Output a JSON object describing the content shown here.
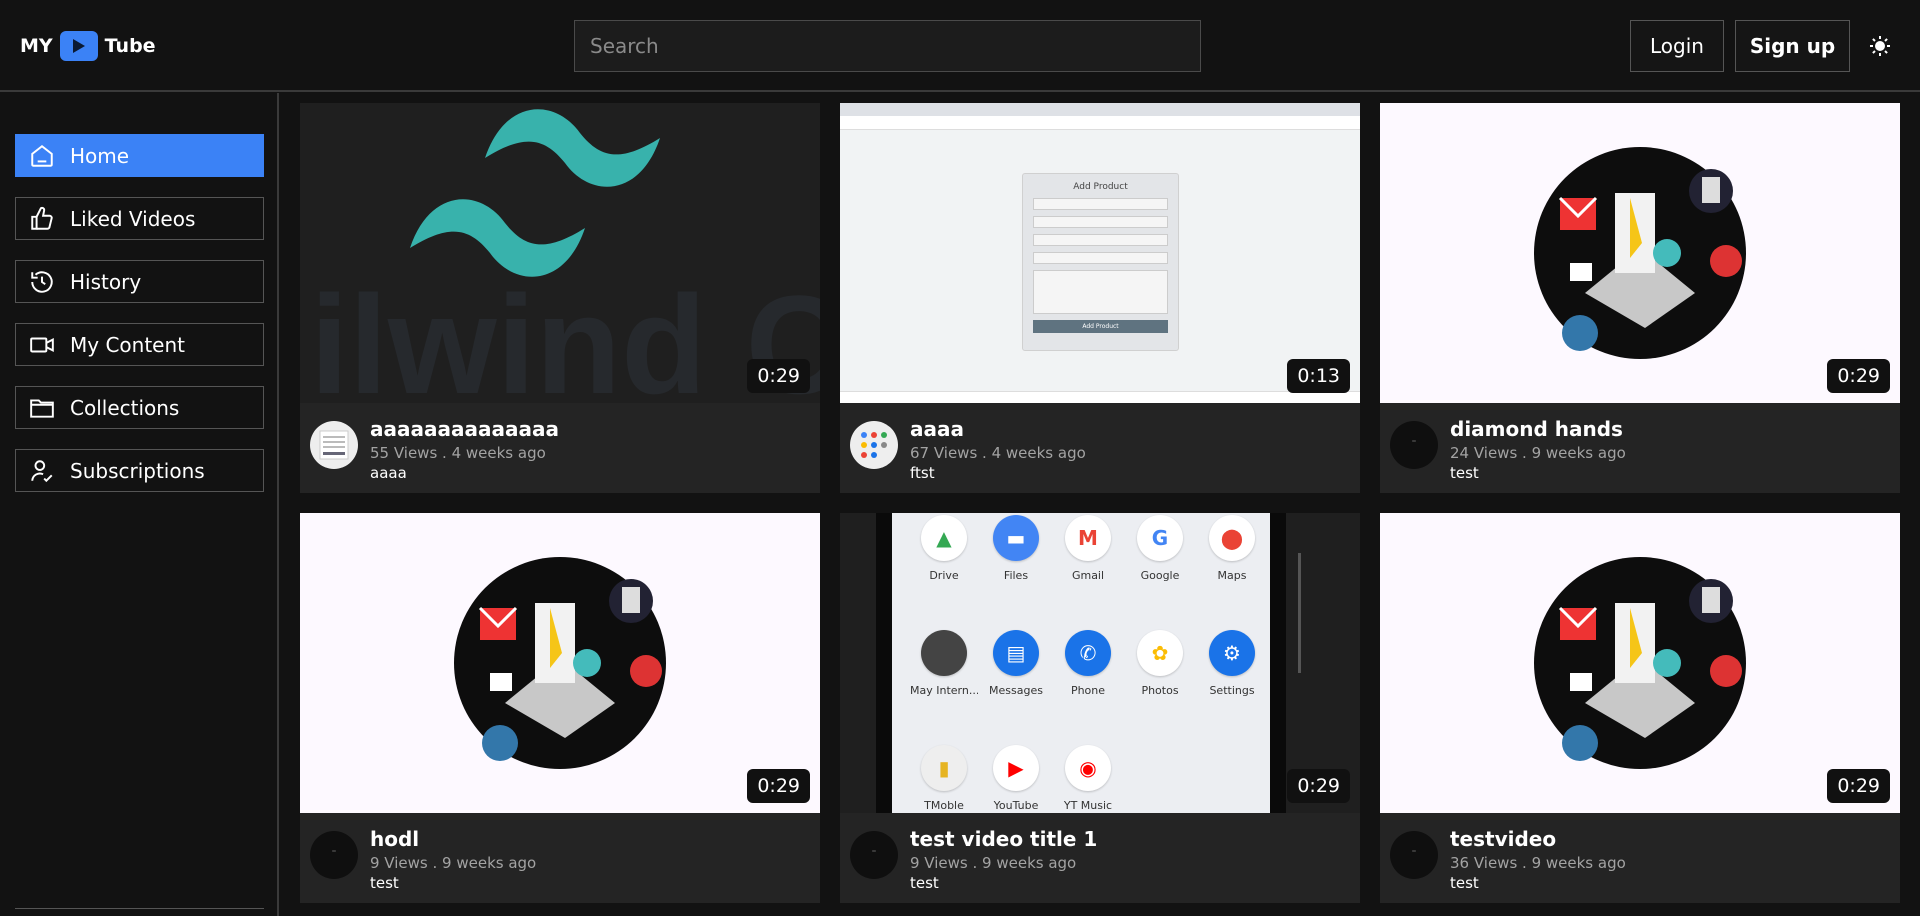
{
  "brand": {
    "left": "MY",
    "right": "Tube"
  },
  "search": {
    "placeholder": "Search"
  },
  "auth": {
    "login": "Login",
    "signup": "Sign up"
  },
  "sidebar": {
    "items": [
      {
        "label": "Home",
        "icon": "home-icon",
        "active": true
      },
      {
        "label": "Liked Videos",
        "icon": "thumbs-up-icon",
        "active": false
      },
      {
        "label": "History",
        "icon": "history-icon",
        "active": false
      },
      {
        "label": "My Content",
        "icon": "video-camera-icon",
        "active": false
      },
      {
        "label": "Collections",
        "icon": "folder-icon",
        "active": false
      },
      {
        "label": "Subscriptions",
        "icon": "user-check-icon",
        "active": false
      }
    ]
  },
  "videos": [
    {
      "title": "aaaaaaaaaaaaaa",
      "meta": "55 Views . 4 weeks ago",
      "channel": "aaaa",
      "duration": "0:29",
      "thumb": "tailwind"
    },
    {
      "title": "aaaa",
      "meta": "67 Views . 4 weeks ago",
      "channel": "ftst",
      "duration": "0:13",
      "thumb": "form",
      "form_title": "Add Product",
      "form_button": "Add Product"
    },
    {
      "title": "diamond hands",
      "meta": "24 Views . 9 weeks ago",
      "channel": "test",
      "duration": "0:29",
      "thumb": "laptop"
    },
    {
      "title": "hodl",
      "meta": "9 Views . 9 weeks ago",
      "channel": "test",
      "duration": "0:29",
      "thumb": "laptop"
    },
    {
      "title": "test video title 1",
      "meta": "9 Views . 9 weeks ago",
      "channel": "test",
      "duration": "0:29",
      "thumb": "phone"
    },
    {
      "title": "testvideo",
      "meta": "36 Views . 9 weeks ago",
      "channel": "test",
      "duration": "0:29",
      "thumb": "laptop"
    }
  ],
  "phone_apps": [
    "Drive",
    "Files",
    "Gmail",
    "Google",
    "Maps",
    "May Intern...",
    "Messages",
    "Phone",
    "Photos",
    "Settings",
    "TMoble",
    "YouTube",
    "YT Music"
  ],
  "colors": {
    "accent": "#3b82f6",
    "background": "#121212",
    "card": "#242424"
  }
}
